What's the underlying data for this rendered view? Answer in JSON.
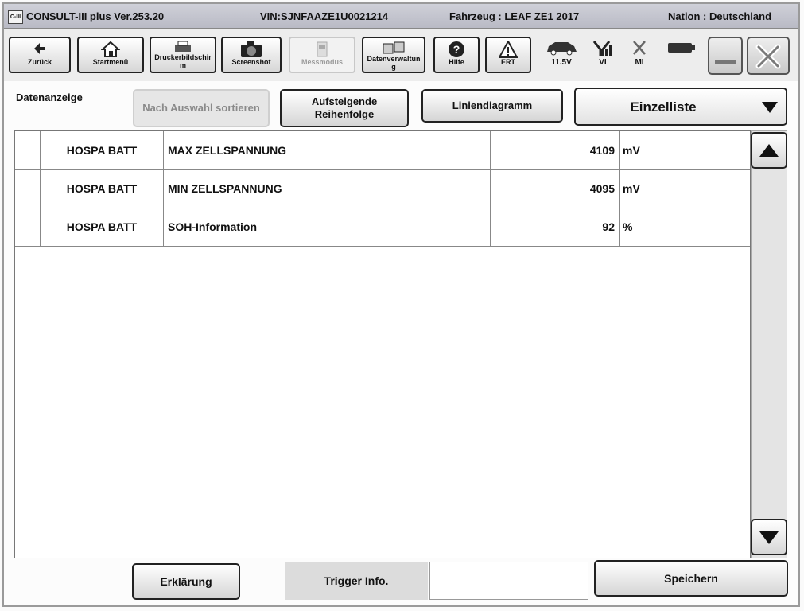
{
  "titlebar": {
    "logo": "C-III",
    "app": "CONSULT-III plus  Ver.253.20",
    "vin": "VIN:SJNFAAZE1U0021214",
    "vehicle": "Fahrzeug : LEAF ZE1 2017",
    "nation": "Nation : Deutschland"
  },
  "toolbar": {
    "back": "Zurück",
    "home": "Startmenü",
    "print": "Druckerbildschirm",
    "screenshot": "Screenshot",
    "measure": "Messmodus",
    "data": "Datenverwaltung",
    "help": "Hilfe",
    "ert": "ERT",
    "battery_voltage": "11.5V",
    "vi": "VI",
    "mi": "MI"
  },
  "controls": {
    "datenanzeige": "Datenanzeige",
    "sort_selection": "Nach Auswahl sortieren",
    "ascending": "Aufsteigende Reihenfolge",
    "line_chart": "Liniendiagramm",
    "view_select": "Einzelliste"
  },
  "table": {
    "rows": [
      {
        "system": "HOSPA BATT",
        "item": "MAX ZELLSPANNUNG",
        "value": "4109",
        "unit": "mV"
      },
      {
        "system": "HOSPA BATT",
        "item": "MIN ZELLSPANNUNG",
        "value": "4095",
        "unit": "mV"
      },
      {
        "system": "HOSPA BATT",
        "item": "SOH-Information",
        "value": "92",
        "unit": "%"
      }
    ]
  },
  "footer": {
    "explain": "Erklärung",
    "trigger": "Trigger Info.",
    "save": "Speichern"
  }
}
